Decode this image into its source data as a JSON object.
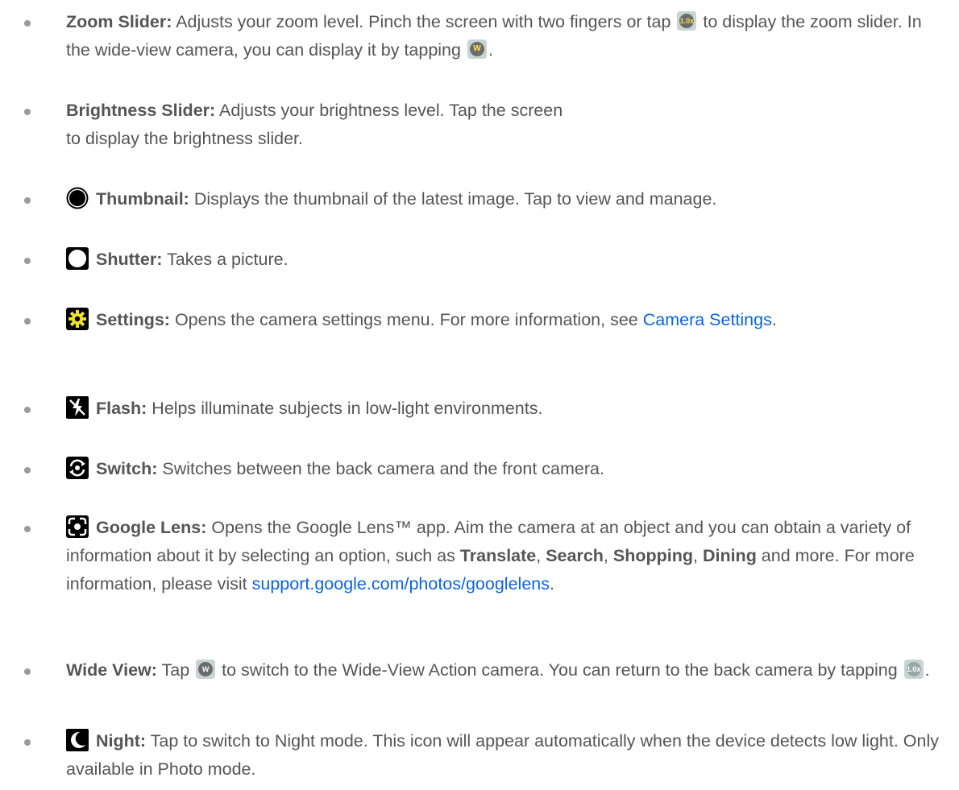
{
  "items": [
    {
      "term": "Zoom Slider:",
      "text1": " Adjusts your zoom level. Pinch the screen with two fingers or tap ",
      "badge1": "1.0x",
      "text2": " to display the zoom slider. In the wide-view camera, you can display it by tapping ",
      "badge2": "W",
      "text3": "."
    },
    {
      "term": "Brightness Slider:",
      "text1": " Adjusts your brightness level. Tap the screen to display the brightness slider."
    },
    {
      "icon": "thumbnail-icon",
      "term": "Thumbnail:",
      "text1": " Displays the thumbnail of the latest image. Tap to view and manage."
    },
    {
      "icon": "shutter-icon",
      "term": "Shutter:",
      "text1": " Takes a picture."
    },
    {
      "icon": "gear-icon",
      "term": "Settings:",
      "text1": " Opens the camera settings menu. For more information, see ",
      "link": "Camera Settings",
      "text2": "."
    },
    {
      "icon": "flash-off-icon",
      "term": "Flash:",
      "text1": " Helps illuminate subjects in low-light environments."
    },
    {
      "icon": "switch-camera-icon",
      "term": "Switch:",
      "text1": " Switches between the back camera and the front camera."
    },
    {
      "icon": "google-lens-icon",
      "term": "Google Lens:",
      "text1": " Opens the Google Lens™ app. Aim the camera at an object and you can obtain a variety of information about it by selecting an option, such as ",
      "b1": "Translate",
      "c1": ", ",
      "b2": "Search",
      "c2": ", ",
      "b3": "Shopping",
      "c3": ", ",
      "b4": "Dining",
      "text2": " and more. For more information, please visit ",
      "link": "support.google.com/photos/googlelens",
      "text3": "."
    },
    {
      "term": "Wide View:",
      "text1": " Tap ",
      "badge1": "W",
      "text2": " to switch to the Wide-View Action camera. You can return to the back camera by tapping ",
      "badge2": "1.0x",
      "text3": "."
    },
    {
      "icon": "night-icon",
      "term": "Night:",
      "text1": " Tap to switch to Night mode. This icon will appear automatically when the device detects low light. Only available in Photo mode."
    }
  ]
}
